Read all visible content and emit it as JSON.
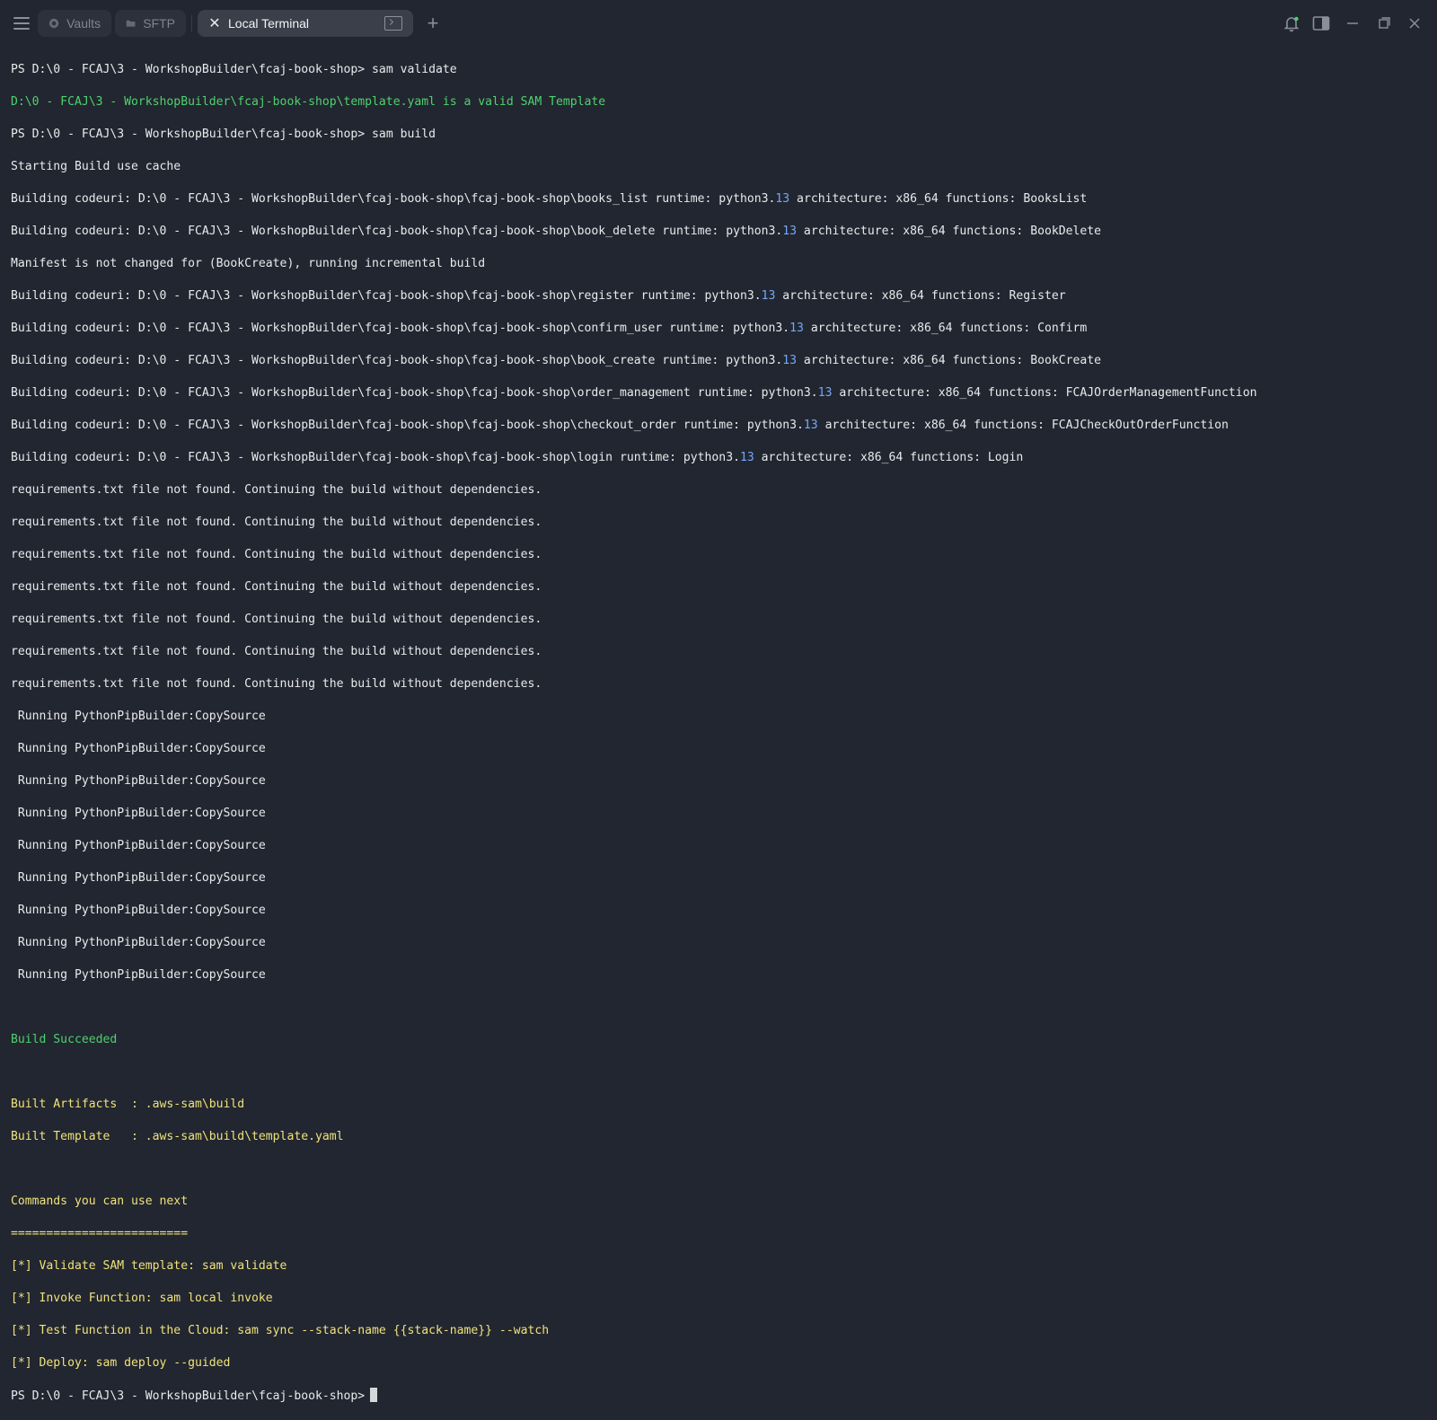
{
  "tabs": {
    "vaults": "Vaults",
    "sftp": "SFTP",
    "local_terminal": "Local Terminal"
  },
  "icons": {
    "menu": "hamburger-menu-icon",
    "vaults": "vault-icon",
    "sftp": "folder-icon",
    "close": "close-icon",
    "terminal": "terminal-icon",
    "add": "plus-icon",
    "notifications": "bell-icon",
    "split": "split-view-icon",
    "minimize": "minimize-icon",
    "restore": "restore-icon",
    "close_window": "close-window-icon"
  },
  "colors": {
    "background": "#222630",
    "active_tab": "#3a3f49",
    "text": "#e9eaec",
    "success": "#4fd16f",
    "summary": "#f0e27a",
    "number": "#74a8f6"
  },
  "terminal": {
    "prompt": "PS D:\\0 - FCAJ\\3 - WorkshopBuilder\\fcaj-book-shop>",
    "cmd_validate": "sam validate",
    "validate_result": "D:\\0 - FCAJ\\3 - WorkshopBuilder\\fcaj-book-shop\\template.yaml is a valid SAM Template",
    "cmd_build": "sam build",
    "start": "Starting Build use cache",
    "runtime_version": "13",
    "builds": [
      {
        "prefix": "Building codeuri: D:\\0 - FCAJ\\3 - WorkshopBuilder\\fcaj-book-shop\\fcaj-book-shop\\books_list runtime: python3.",
        "suffix": " architecture: x86_64 functions: BooksList"
      },
      {
        "prefix": "Building codeuri: D:\\0 - FCAJ\\3 - WorkshopBuilder\\fcaj-book-shop\\fcaj-book-shop\\book_delete runtime: python3.",
        "suffix": " architecture: x86_64 functions: BookDelete"
      },
      {
        "prefix": "Building codeuri: D:\\0 - FCAJ\\3 - WorkshopBuilder\\fcaj-book-shop\\fcaj-book-shop\\register runtime: python3.",
        "suffix": " architecture: x86_64 functions: Register"
      },
      {
        "prefix": "Building codeuri: D:\\0 - FCAJ\\3 - WorkshopBuilder\\fcaj-book-shop\\fcaj-book-shop\\confirm_user runtime: python3.",
        "suffix": " architecture: x86_64 functions: Confirm"
      },
      {
        "prefix": "Building codeuri: D:\\0 - FCAJ\\3 - WorkshopBuilder\\fcaj-book-shop\\fcaj-book-shop\\book_create runtime: python3.",
        "suffix": " architecture: x86_64 functions: BookCreate"
      },
      {
        "prefix": "Building codeuri: D:\\0 - FCAJ\\3 - WorkshopBuilder\\fcaj-book-shop\\fcaj-book-shop\\order_management runtime: python3.",
        "suffix": " architecture: x86_64 functions: FCAJOrderManagementFunction"
      },
      {
        "prefix": "Building codeuri: D:\\0 - FCAJ\\3 - WorkshopBuilder\\fcaj-book-shop\\fcaj-book-shop\\checkout_order runtime: python3.",
        "suffix": " architecture: x86_64 functions: FCAJCheckOutOrderFunction"
      },
      {
        "prefix": "Building codeuri: D:\\0 - FCAJ\\3 - WorkshopBuilder\\fcaj-book-shop\\fcaj-book-shop\\login runtime: python3.",
        "suffix": " architecture: x86_64 functions: Login"
      }
    ],
    "manifest": "Manifest is not changed for (BookCreate), running incremental build",
    "requirements_warning": "requirements.txt file not found. Continuing the build without dependencies.",
    "running": " Running PythonPipBuilder:CopySource",
    "succeeded": "Build Succeeded",
    "artifacts": "Built Artifacts  : .aws-sam\\build",
    "template": "Built Template   : .aws-sam\\build\\template.yaml",
    "next_heading": "Commands you can use next",
    "next_rule": "=========================",
    "next_commands": [
      "[*] Validate SAM template: sam validate",
      "[*] Invoke Function: sam local invoke",
      "[*] Test Function in the Cloud: sam sync --stack-name {{stack-name}} --watch",
      "[*] Deploy: sam deploy --guided"
    ]
  }
}
